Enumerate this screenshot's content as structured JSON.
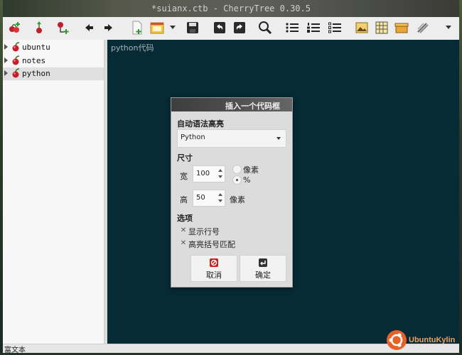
{
  "window": {
    "title": "*suianx.ctb - CherryTree 0.30.5"
  },
  "toolbar": {
    "icons": [
      "add-node-icon",
      "add-subnode-icon",
      "add-child-node-icon",
      "back-arrow-icon",
      "forward-arrow-icon",
      "new-file-icon",
      "open-folder-icon",
      "dropdown-arrow-icon",
      "save-icon",
      "undo-icon",
      "redo-icon",
      "search-icon",
      "bullet-list-icon",
      "numbered-list-icon",
      "todo-list-icon",
      "insert-image-icon",
      "insert-table-icon",
      "insert-codebox-icon",
      "insert-link-icon",
      "overflow-arrow-icon"
    ]
  },
  "tree": {
    "items": [
      {
        "label": "ubuntu",
        "selected": false
      },
      {
        "label": "notes",
        "selected": false
      },
      {
        "label": "python",
        "selected": true
      }
    ]
  },
  "editor": {
    "text": "python代码"
  },
  "status": {
    "text": "富文本"
  },
  "dialog": {
    "title": "插入一个代码框",
    "syntax_label": "自动语法高亮",
    "syntax_value": "Python",
    "size_label": "尺寸",
    "width_label": "宽",
    "width_value": "100",
    "width_unit_pixels": "像素",
    "width_unit_percent": "%",
    "width_unit_selected": "%",
    "height_label": "高",
    "height_value": "50",
    "height_unit": "像素",
    "options_label": "选项",
    "show_line_numbers": "显示行号",
    "highlight_brackets": "高亮括号匹配",
    "cancel_label": "取消",
    "ok_label": "确定"
  },
  "brand": {
    "text": "UbuntuKylin"
  },
  "colors": {
    "editor_bg": "#062b36",
    "accent_cancel": "#c8201e",
    "accent_ok": "#333333",
    "brand": "#e8612a"
  }
}
